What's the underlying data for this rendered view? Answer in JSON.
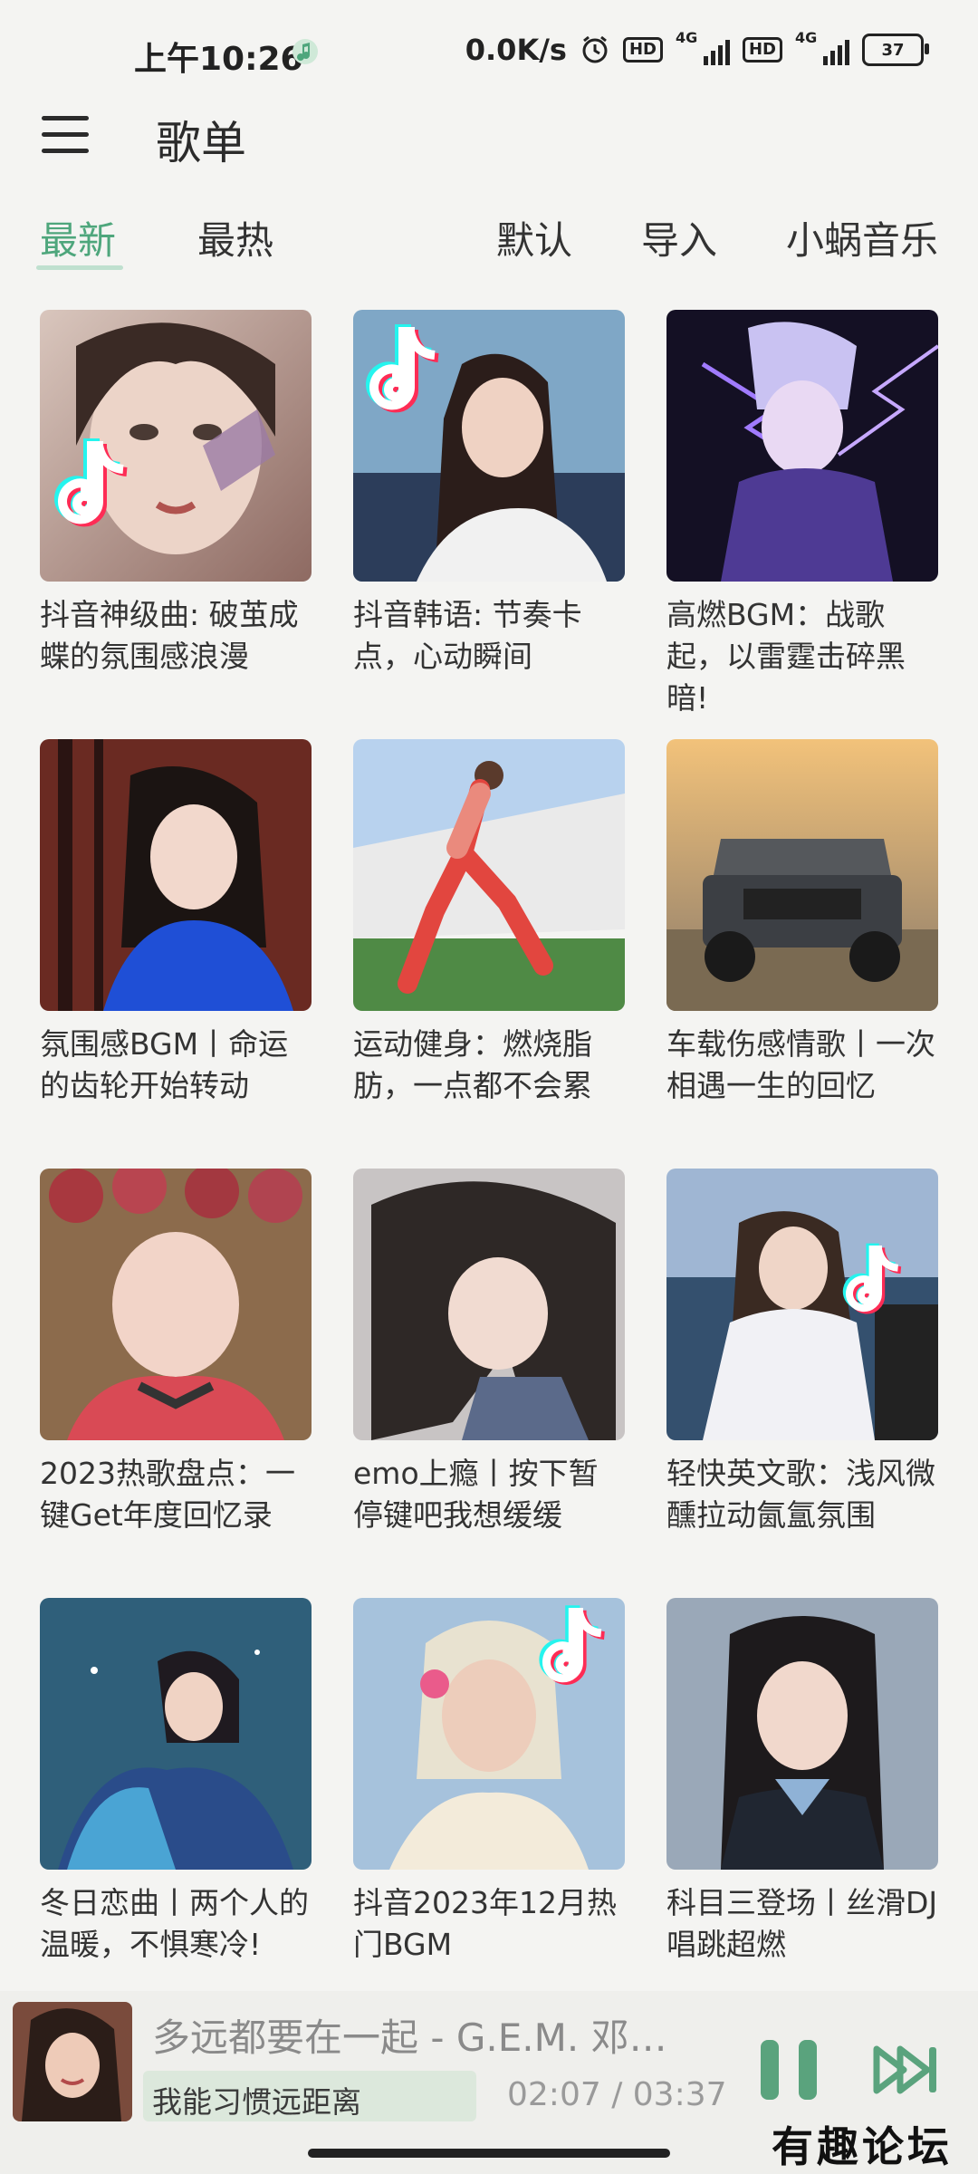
{
  "status_bar": {
    "time": "上午10:26",
    "net_speed": "0.0K/s",
    "hd1": "HD",
    "sig1": "4G",
    "hd2": "HD",
    "sig2": "4G",
    "battery": "37"
  },
  "header": {
    "title": "歌单",
    "menu_icon": "menu-icon"
  },
  "tabs": [
    {
      "label": "最新",
      "active": true
    },
    {
      "label": "最热",
      "active": false
    },
    {
      "label": "默认",
      "active": false
    },
    {
      "label": "导入",
      "active": false
    },
    {
      "label": "小蜗音乐",
      "active": false
    }
  ],
  "playlists": [
    {
      "title": "抖音神级曲: 破茧成蝶的氛围感浪漫"
    },
    {
      "title": "抖音韩语: 节奏卡点，心动瞬间"
    },
    {
      "title": "高燃BGM：战歌起，以雷霆击碎黑暗!"
    },
    {
      "title": "氛围感BGM丨命运的齿轮开始转动"
    },
    {
      "title": "运动健身：燃烧脂肪，一点都不会累"
    },
    {
      "title": "车载伤感情歌丨一次相遇一生的回忆"
    },
    {
      "title": "2023热歌盘点：一键Get年度回忆录"
    },
    {
      "title": "emo上瘾丨按下暂停键吧我想缓缓"
    },
    {
      "title": "轻快英文歌：浅风微醺拉动氤氲氛围"
    },
    {
      "title": "冬日恋曲丨两个人的温暖，不惧寒冷!"
    },
    {
      "title": "抖音2023年12月热门BGM"
    },
    {
      "title": "科目三登场丨丝滑DJ唱跳超燃"
    }
  ],
  "player": {
    "title": "多远都要在一起 - G.E.M. 邓…",
    "lyric": "我能习惯远距离",
    "time": "02:07 / 03:37",
    "progress": 0.585,
    "accent": "#5aa37d"
  },
  "watermark": "有趣论坛",
  "colors": {
    "accent": "#4ea67c",
    "background": "#f4f4f2"
  }
}
